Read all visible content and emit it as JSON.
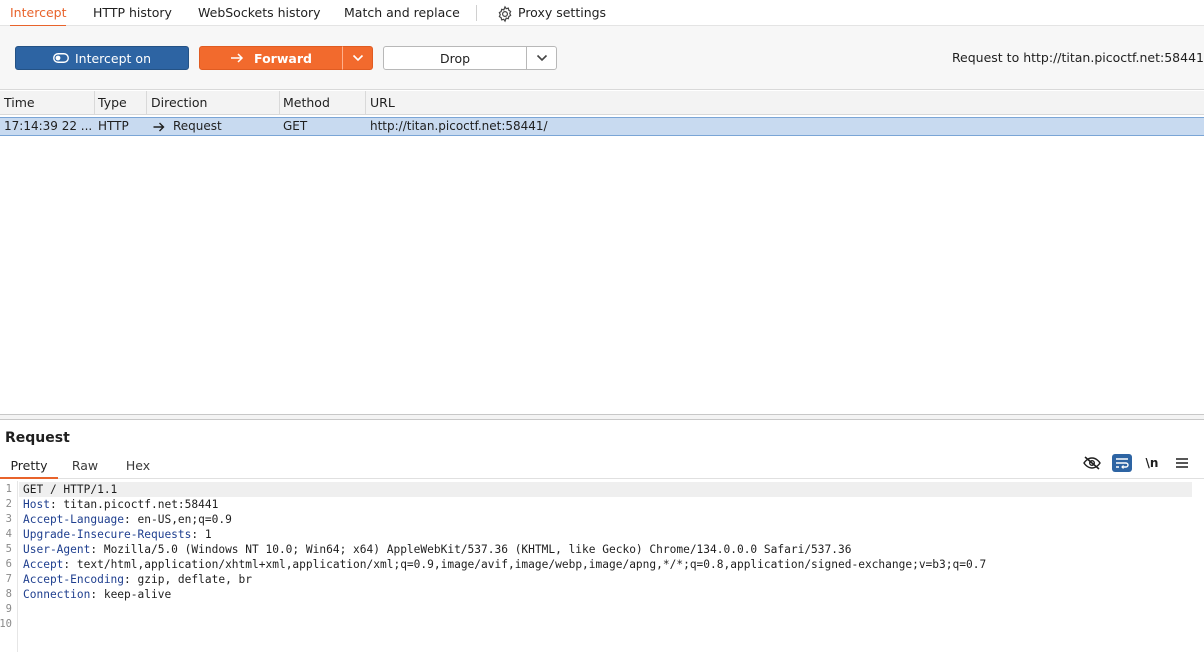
{
  "tabs": {
    "intercept": "Intercept",
    "http_history": "HTTP history",
    "websockets_history": "WebSockets history",
    "match_replace": "Match and replace",
    "proxy_settings": "Proxy settings"
  },
  "toolbar": {
    "intercept_label": "Intercept on",
    "forward_label": "Forward",
    "drop_label": "Drop",
    "request_to": "Request to http://titan.picoctf.net:58441"
  },
  "table": {
    "headers": {
      "time": "Time",
      "type": "Type",
      "direction": "Direction",
      "method": "Method",
      "url": "URL"
    },
    "row": {
      "time": "17:14:39 22 ...",
      "type": "HTTP",
      "direction": "Request",
      "method": "GET",
      "url": "http://titan.picoctf.net:58441/"
    }
  },
  "request": {
    "title": "Request",
    "tabs": {
      "pretty": "Pretty",
      "raw": "Raw",
      "hex": "Hex"
    },
    "newline_toggle": "\\n",
    "line_numbers": [
      "1",
      "2",
      "3",
      "4",
      "5",
      "6",
      "7",
      "8",
      "9",
      "10"
    ],
    "lines": [
      {
        "key": "",
        "value": "GET / HTTP/1.1"
      },
      {
        "key": "Host",
        "value": ": titan.picoctf.net:58441"
      },
      {
        "key": "Accept-Language",
        "value": ": en-US,en;q=0.9"
      },
      {
        "key": "Upgrade-Insecure-Requests",
        "value": ": 1"
      },
      {
        "key": "User-Agent",
        "value": ": Mozilla/5.0 (Windows NT 10.0; Win64; x64) AppleWebKit/537.36 (KHTML, like Gecko) Chrome/134.0.0.0 Safari/537.36"
      },
      {
        "key": "Accept",
        "value": ": text/html,application/xhtml+xml,application/xml;q=0.9,image/avif,image/webp,image/apng,*/*;q=0.8,application/signed-exchange;v=b3;q=0.7"
      },
      {
        "key": "Accept-Encoding",
        "value": ": gzip, deflate, br"
      },
      {
        "key": "Connection",
        "value": ": keep-alive"
      }
    ]
  },
  "colors": {
    "accent": "#e8632b",
    "intercept_blue": "#2d64a3",
    "forward_orange": "#f26a2d",
    "selected_row": "#c8daf0",
    "header_key": "#1f3f8f"
  },
  "icons": {
    "proxy_settings": "gear-icon",
    "intercept": "toggle-icon",
    "forward": "arrow-right-icon",
    "dropdown": "chevron-down-icon",
    "direction": "arrow-right-icon",
    "hide": "eye-off-icon",
    "wrap": "wrap-lines-icon",
    "menu": "hamburger-menu-icon"
  }
}
